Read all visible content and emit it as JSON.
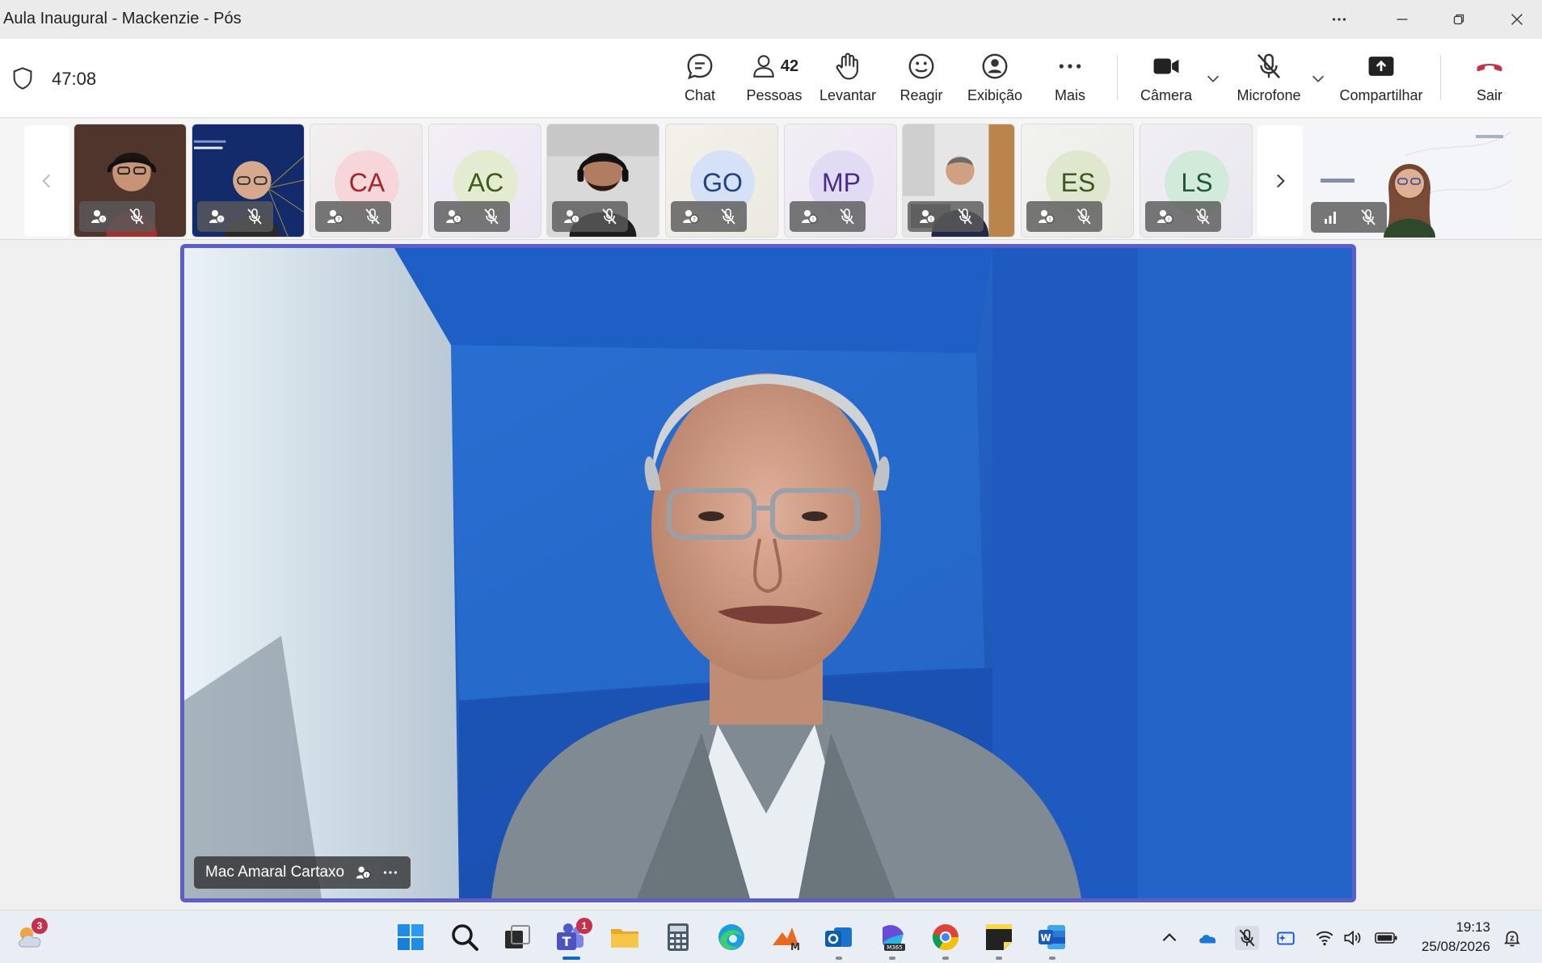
{
  "window": {
    "title": "Aula Inaugural - Mackenzie - Pós"
  },
  "meeting": {
    "timer": "47:08"
  },
  "toolbar": {
    "chat_label": "Chat",
    "people_label": "Pessoas",
    "people_count": "42",
    "raise_label": "Levantar",
    "react_label": "Reagir",
    "view_label": "Exibição",
    "more_label": "Mais",
    "camera_label": "Câmera",
    "mic_label": "Microfone",
    "share_label": "Compartilhar",
    "leave_label": "Sair"
  },
  "participants": [
    {
      "type": "video",
      "muted": true
    },
    {
      "type": "video",
      "muted": true
    },
    {
      "type": "initials",
      "initials": "CA",
      "muted": true,
      "color": "#a4262c",
      "bg": "#f6d6d8"
    },
    {
      "type": "initials",
      "initials": "AC",
      "muted": true,
      "color": "#405a19",
      "bg": "#e3ecd0"
    },
    {
      "type": "video",
      "muted": true
    },
    {
      "type": "initials",
      "initials": "GO",
      "muted": true,
      "color": "#1f3f8a",
      "bg": "#d5e1f7"
    },
    {
      "type": "initials",
      "initials": "MP",
      "muted": true,
      "color": "#4a2a8a",
      "bg": "#e2dbf4"
    },
    {
      "type": "video",
      "muted": true
    },
    {
      "type": "initials",
      "initials": "ES",
      "muted": true,
      "color": "#3d5a1c",
      "bg": "#dfe8cf"
    },
    {
      "type": "initials",
      "initials": "LS",
      "muted": true,
      "color": "#1c5a3a",
      "bg": "#d2ead9"
    }
  ],
  "main_speaker": {
    "name": "Mac Amaral Cartaxo"
  },
  "taskbar": {
    "weather_badge": "3",
    "teams_badge": "1",
    "time": "19:13",
    "date": "25/08/2026"
  },
  "colors": {
    "accent": "#5b5fc7",
    "leave": "#c4314b"
  }
}
